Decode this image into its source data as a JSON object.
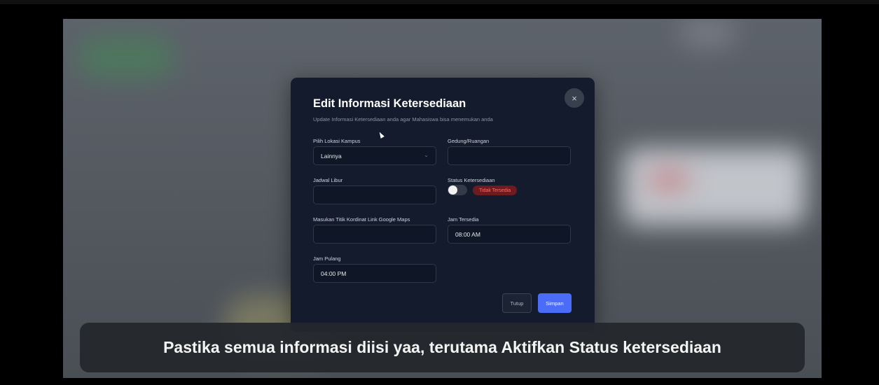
{
  "modal": {
    "title": "Edit Informasi Ketersediaan",
    "subtitle": "Update Informasi Ketersediaan anda agar Mahasiswa bisa menemukan anda",
    "close_icon": "×",
    "fields": {
      "lokasi_kampus": {
        "label": "Pilih Lokasi Kampus",
        "value": "Lainnya",
        "chevron": "⌄"
      },
      "gedung_ruangan": {
        "label": "Gedung/Ruangan",
        "value": ""
      },
      "jadwal_libur": {
        "label": "Jadwal Libur",
        "value": ""
      },
      "status": {
        "label": "Status Ketersediaan",
        "on": false,
        "badge": "Tidak Tersedia"
      },
      "kordinat": {
        "label": "Masukan Titik Kordinat Link Google Maps",
        "value": ""
      },
      "jam_tersedia": {
        "label": "Jam Tersedia",
        "value": "08:00 AM"
      },
      "jam_pulang": {
        "label": "Jam Pulang",
        "value": "04:00 PM"
      }
    },
    "buttons": {
      "close": "Tutup",
      "save": "Simpan"
    }
  },
  "caption": "Pastika semua informasi diisi yaa, terutama Aktifkan Status ketersediaan",
  "colors": {
    "modal_bg": "#131b2c",
    "primary": "#4a6cf7",
    "badge_bg": "#6e1b1f",
    "badge_text": "#ff6d6d"
  }
}
